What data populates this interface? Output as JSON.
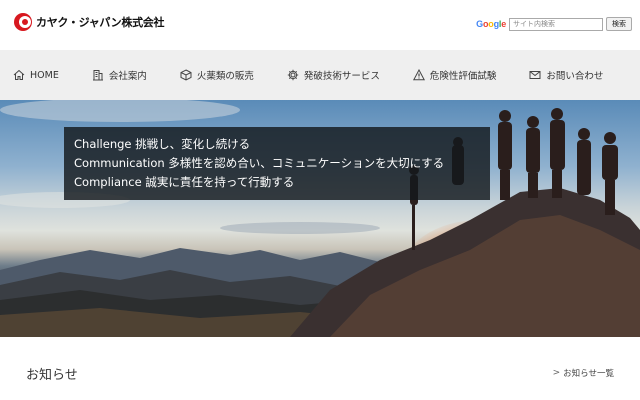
{
  "header": {
    "logo_text": "カヤク・ジャパン株式会社",
    "search": {
      "google_label": "Google",
      "placeholder": "サイト内検索",
      "button_label": "検索"
    }
  },
  "nav": {
    "items": [
      {
        "label": "HOME",
        "icon": "home-icon"
      },
      {
        "label": "会社案内",
        "icon": "building-icon"
      },
      {
        "label": "火薬類の販売",
        "icon": "box-icon"
      },
      {
        "label": "発破技術サービス",
        "icon": "gear-icon"
      },
      {
        "label": "危険性評価試験",
        "icon": "warning-icon"
      },
      {
        "label": "お問い合わせ",
        "icon": "mail-icon"
      }
    ]
  },
  "hero": {
    "motto": [
      "Challenge 挑戦し、変化し続ける",
      "Communication 多様性を認め合い、コミュニケーションを大切にする",
      "Compliance 誠実に責任を持って行動する"
    ]
  },
  "news": {
    "title": "お知らせ",
    "link_label": "お知らせ一覧"
  },
  "colors": {
    "brand_red": "#d7181f",
    "nav_bg": "#efefef",
    "motto_bg": "#14181c"
  }
}
